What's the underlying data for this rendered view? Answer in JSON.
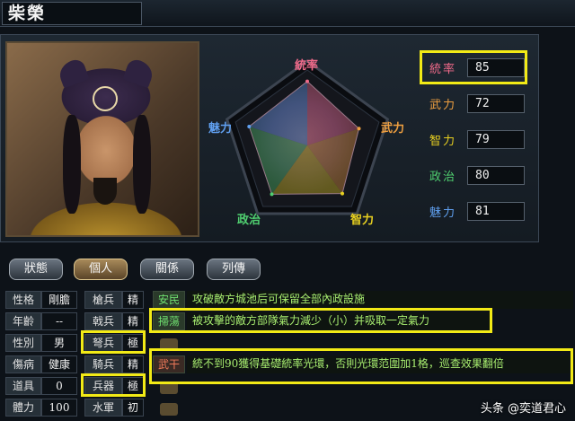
{
  "character": {
    "name": "柴榮"
  },
  "radar": {
    "axes": [
      {
        "label": "統率",
        "value": 85,
        "color": "#f06a8a"
      },
      {
        "label": "武力",
        "value": 72,
        "color": "#f0a040"
      },
      {
        "label": "智力",
        "value": 79,
        "color": "#e8d020"
      },
      {
        "label": "政治",
        "value": 80,
        "color": "#50d070"
      },
      {
        "label": "魅力",
        "value": 81,
        "color": "#60a0f0"
      }
    ]
  },
  "stats": [
    {
      "label": "統率",
      "value": "85",
      "highlighted": true
    },
    {
      "label": "武力",
      "value": "72",
      "highlighted": false
    },
    {
      "label": "智力",
      "value": "79",
      "highlighted": false
    },
    {
      "label": "政治",
      "value": "80",
      "highlighted": false
    },
    {
      "label": "魅力",
      "value": "81",
      "highlighted": false
    }
  ],
  "tabs": [
    "狀態",
    "個人",
    "關係",
    "列傳"
  ],
  "active_tab": "個人",
  "profile": [
    {
      "label": "性格",
      "value": "剛膽"
    },
    {
      "label": "年齡",
      "value": "--"
    },
    {
      "label": "性別",
      "value": "男"
    },
    {
      "label": "傷病",
      "value": "健康"
    },
    {
      "label": "道具",
      "value": "0"
    },
    {
      "label": "體力",
      "value": "100"
    }
  ],
  "troops": [
    {
      "label": "槍兵",
      "value": "精"
    },
    {
      "label": "戟兵",
      "value": "精"
    },
    {
      "label": "弩兵",
      "value": "極"
    },
    {
      "label": "騎兵",
      "value": "精"
    },
    {
      "label": "兵器",
      "value": "極"
    },
    {
      "label": "水軍",
      "value": "初"
    }
  ],
  "skills": [
    {
      "name": "安民",
      "desc": "攻破敵方城池后可保留全部內政設施",
      "style": "green"
    },
    {
      "name": "掃蕩",
      "desc": "被攻擊的敵方部隊氣力減少（小）并吸取一定氣力",
      "style": "green"
    },
    {
      "name": "",
      "desc": "",
      "style": "empty"
    },
    {
      "name": "武干",
      "desc": "統不到90獲得基礎統率光環，否則光環范圍加1格，巡查效果翻倍",
      "style": "red"
    },
    {
      "name": "",
      "desc": "",
      "style": "empty"
    },
    {
      "name": "",
      "desc": "",
      "style": "empty"
    }
  ],
  "watermark": "头条 @奕道君心",
  "colors": {
    "highlight": "#f2ea16",
    "skill_text": "#a8ee70"
  }
}
